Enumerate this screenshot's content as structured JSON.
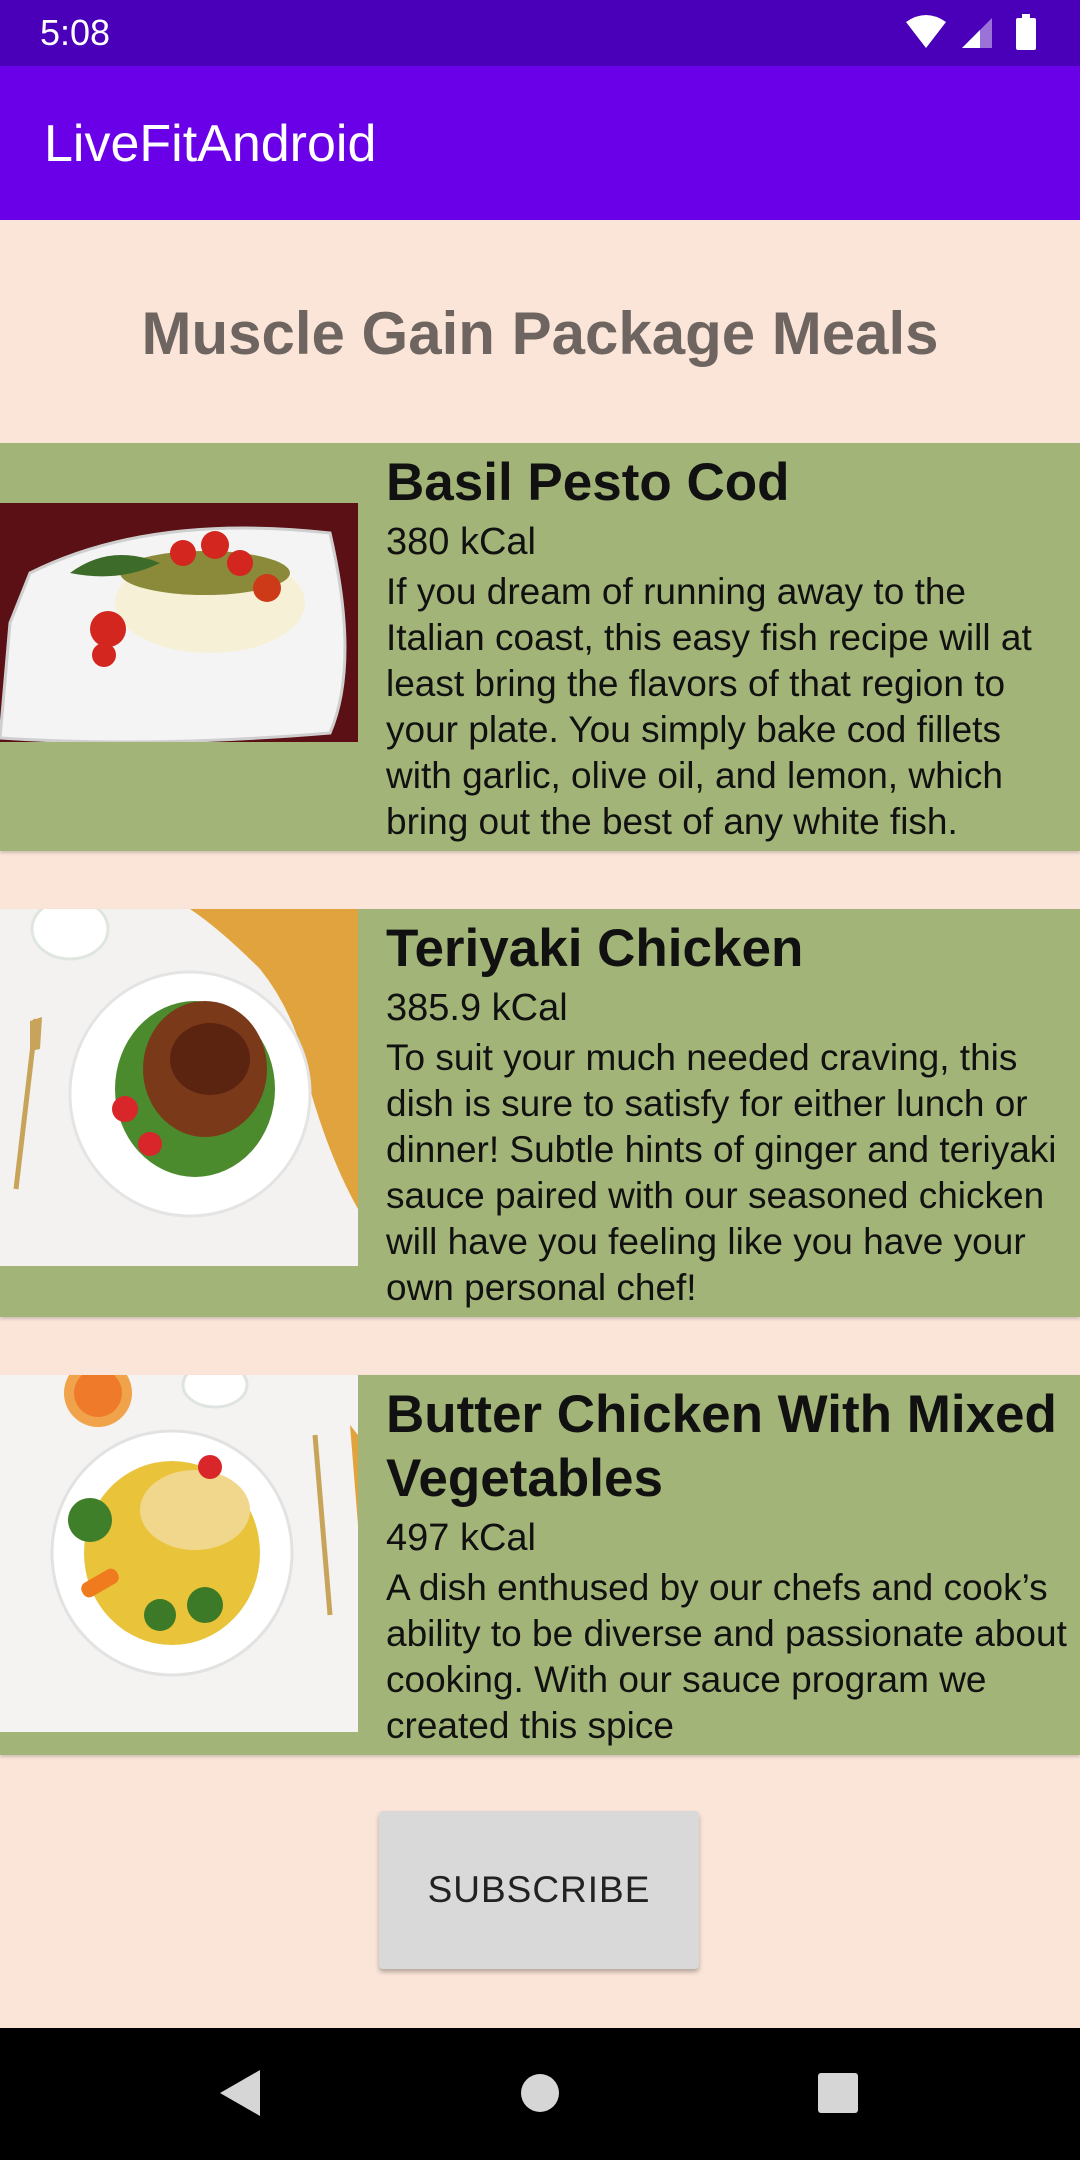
{
  "status_bar": {
    "time": "5:08",
    "icons": [
      "wifi-icon",
      "cellular-signal-icon",
      "battery-icon"
    ]
  },
  "app_bar": {
    "title": "LiveFitAndroid"
  },
  "page": {
    "heading": "Muscle Gain Package Meals"
  },
  "meals": [
    {
      "name": "Basil Pesto Cod",
      "kcal": "380 kCal",
      "description": "If you dream of running away to the Italian coast, this easy fish recipe will at least bring the flavors of that region to your plate. You simply bake cod fillets with garlic, olive oil, and lemon, which bring out the best of any white fish."
    },
    {
      "name": "Teriyaki Chicken",
      "kcal": "385.9 kCal",
      "description": "To suit your much needed craving, this dish is sure to satisfy for either lunch or dinner! Subtle hints of ginger and teriyaki sauce paired with our seasoned chicken will have you feeling like you have your own personal chef!"
    },
    {
      "name": "Butter Chicken With Mixed Vegetables",
      "kcal": "497 kCal",
      "description": "A dish enthused by our chefs and cook’s ability to be diverse and passionate about cooking. With our sauce program we created this spice"
    }
  ],
  "subscribe": {
    "label": "SUBSCRIBE"
  },
  "nav_bar": {
    "buttons": [
      "back-icon",
      "home-icon",
      "recents-icon"
    ]
  },
  "colors": {
    "status_bar": "#4a00b8",
    "app_bar": "#6a00e8",
    "background": "#fbe5d9",
    "card": "#a2b477",
    "heading": "#6e6560",
    "button": "#d9d9d9"
  }
}
